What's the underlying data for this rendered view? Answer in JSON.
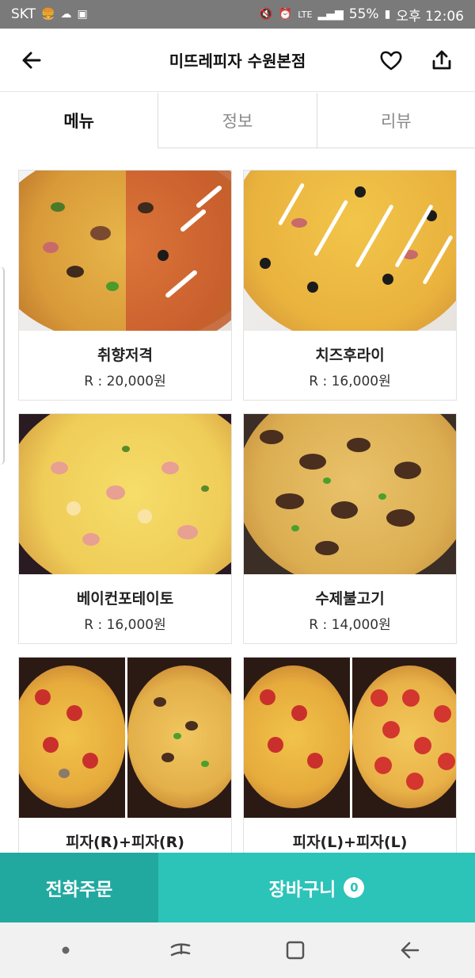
{
  "status_bar": {
    "carrier": "SKT",
    "network": "LTE",
    "battery": "55%",
    "time": "오후 12:06"
  },
  "header": {
    "title": "미뜨레피자 수원본점"
  },
  "tabs": [
    {
      "label": "메뉴",
      "active": true
    },
    {
      "label": "정보",
      "active": false
    },
    {
      "label": "리뷰",
      "active": false
    }
  ],
  "menu_items": [
    {
      "name": "취향저격",
      "price": "R : 20,000원"
    },
    {
      "name": "치즈후라이",
      "price": "R : 16,000원"
    },
    {
      "name": "베이컨포테이토",
      "price": "R : 16,000원"
    },
    {
      "name": "수제불고기",
      "price": "R : 14,000원"
    },
    {
      "name": "피자(R)+피자(R)",
      "price": ""
    },
    {
      "name": "피자(L)+피자(L)",
      "price": ""
    }
  ],
  "actions": {
    "call_label": "전화주문",
    "cart_label": "장바구니",
    "cart_count": "0"
  },
  "colors": {
    "accent": "#2cc3b8",
    "accent_dark": "#21a9a0"
  }
}
